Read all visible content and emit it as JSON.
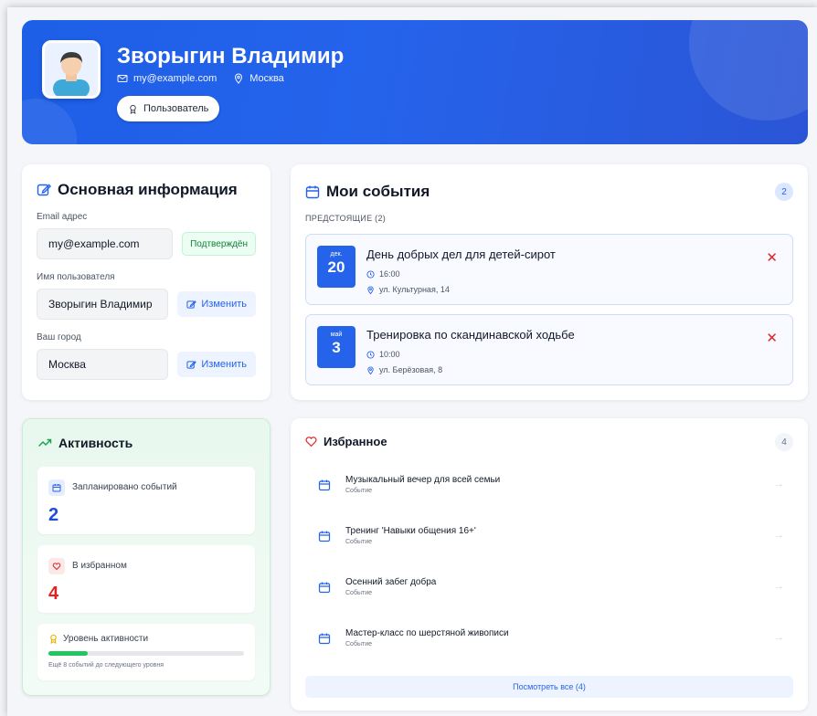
{
  "profile": {
    "name": "Зворыгин Владимир",
    "email": "my@example.com",
    "city": "Москва",
    "role": "Пользователь"
  },
  "info": {
    "title": "Основная информация",
    "email_label": "Email адрес",
    "email_value": "my@example.com",
    "email_status": "Подтверждён",
    "username_label": "Имя пользователя",
    "username_value": "Зворыгин Владимир",
    "city_label": "Ваш город",
    "city_value": "Москва",
    "edit_label": "Изменить"
  },
  "events": {
    "title": "Мои события",
    "count": "2",
    "upcoming_label": "ПРЕДСТОЯЩИЕ (2)",
    "items": [
      {
        "month": "дек.",
        "day": "20",
        "title": "День добрых дел для детей-сирот",
        "time": "16:00",
        "place": "ул. Культурная, 14"
      },
      {
        "month": "май",
        "day": "3",
        "title": "Тренировка по скандинавской ходьбе",
        "time": "10:00",
        "place": "ул. Берёзовая, 8"
      }
    ]
  },
  "activity": {
    "title": "Активность",
    "planned_label": "Запланировано событий",
    "planned_value": "2",
    "fav_label": "В избранном",
    "fav_value": "4",
    "level_label": "Уровень активности",
    "level_progress": 0.2,
    "level_hint": "Ещё 8 событий до следующего уровня"
  },
  "favorites": {
    "title": "Избранное",
    "count": "4",
    "items": [
      {
        "title": "Музыкальный вечер для всей семьи",
        "kind": "Событие"
      },
      {
        "title": "Тренинг 'Навыки общения 16+'",
        "kind": "Событие"
      },
      {
        "title": "Осенний забег добра",
        "kind": "Событие"
      },
      {
        "title": "Мастер-класс по шерстяной живописи",
        "kind": "Событие"
      }
    ],
    "see_all": "Посмотреть все (4)"
  },
  "colors": {
    "accent": "#2563eb",
    "success": "#22c55e",
    "danger": "#dc2626"
  }
}
